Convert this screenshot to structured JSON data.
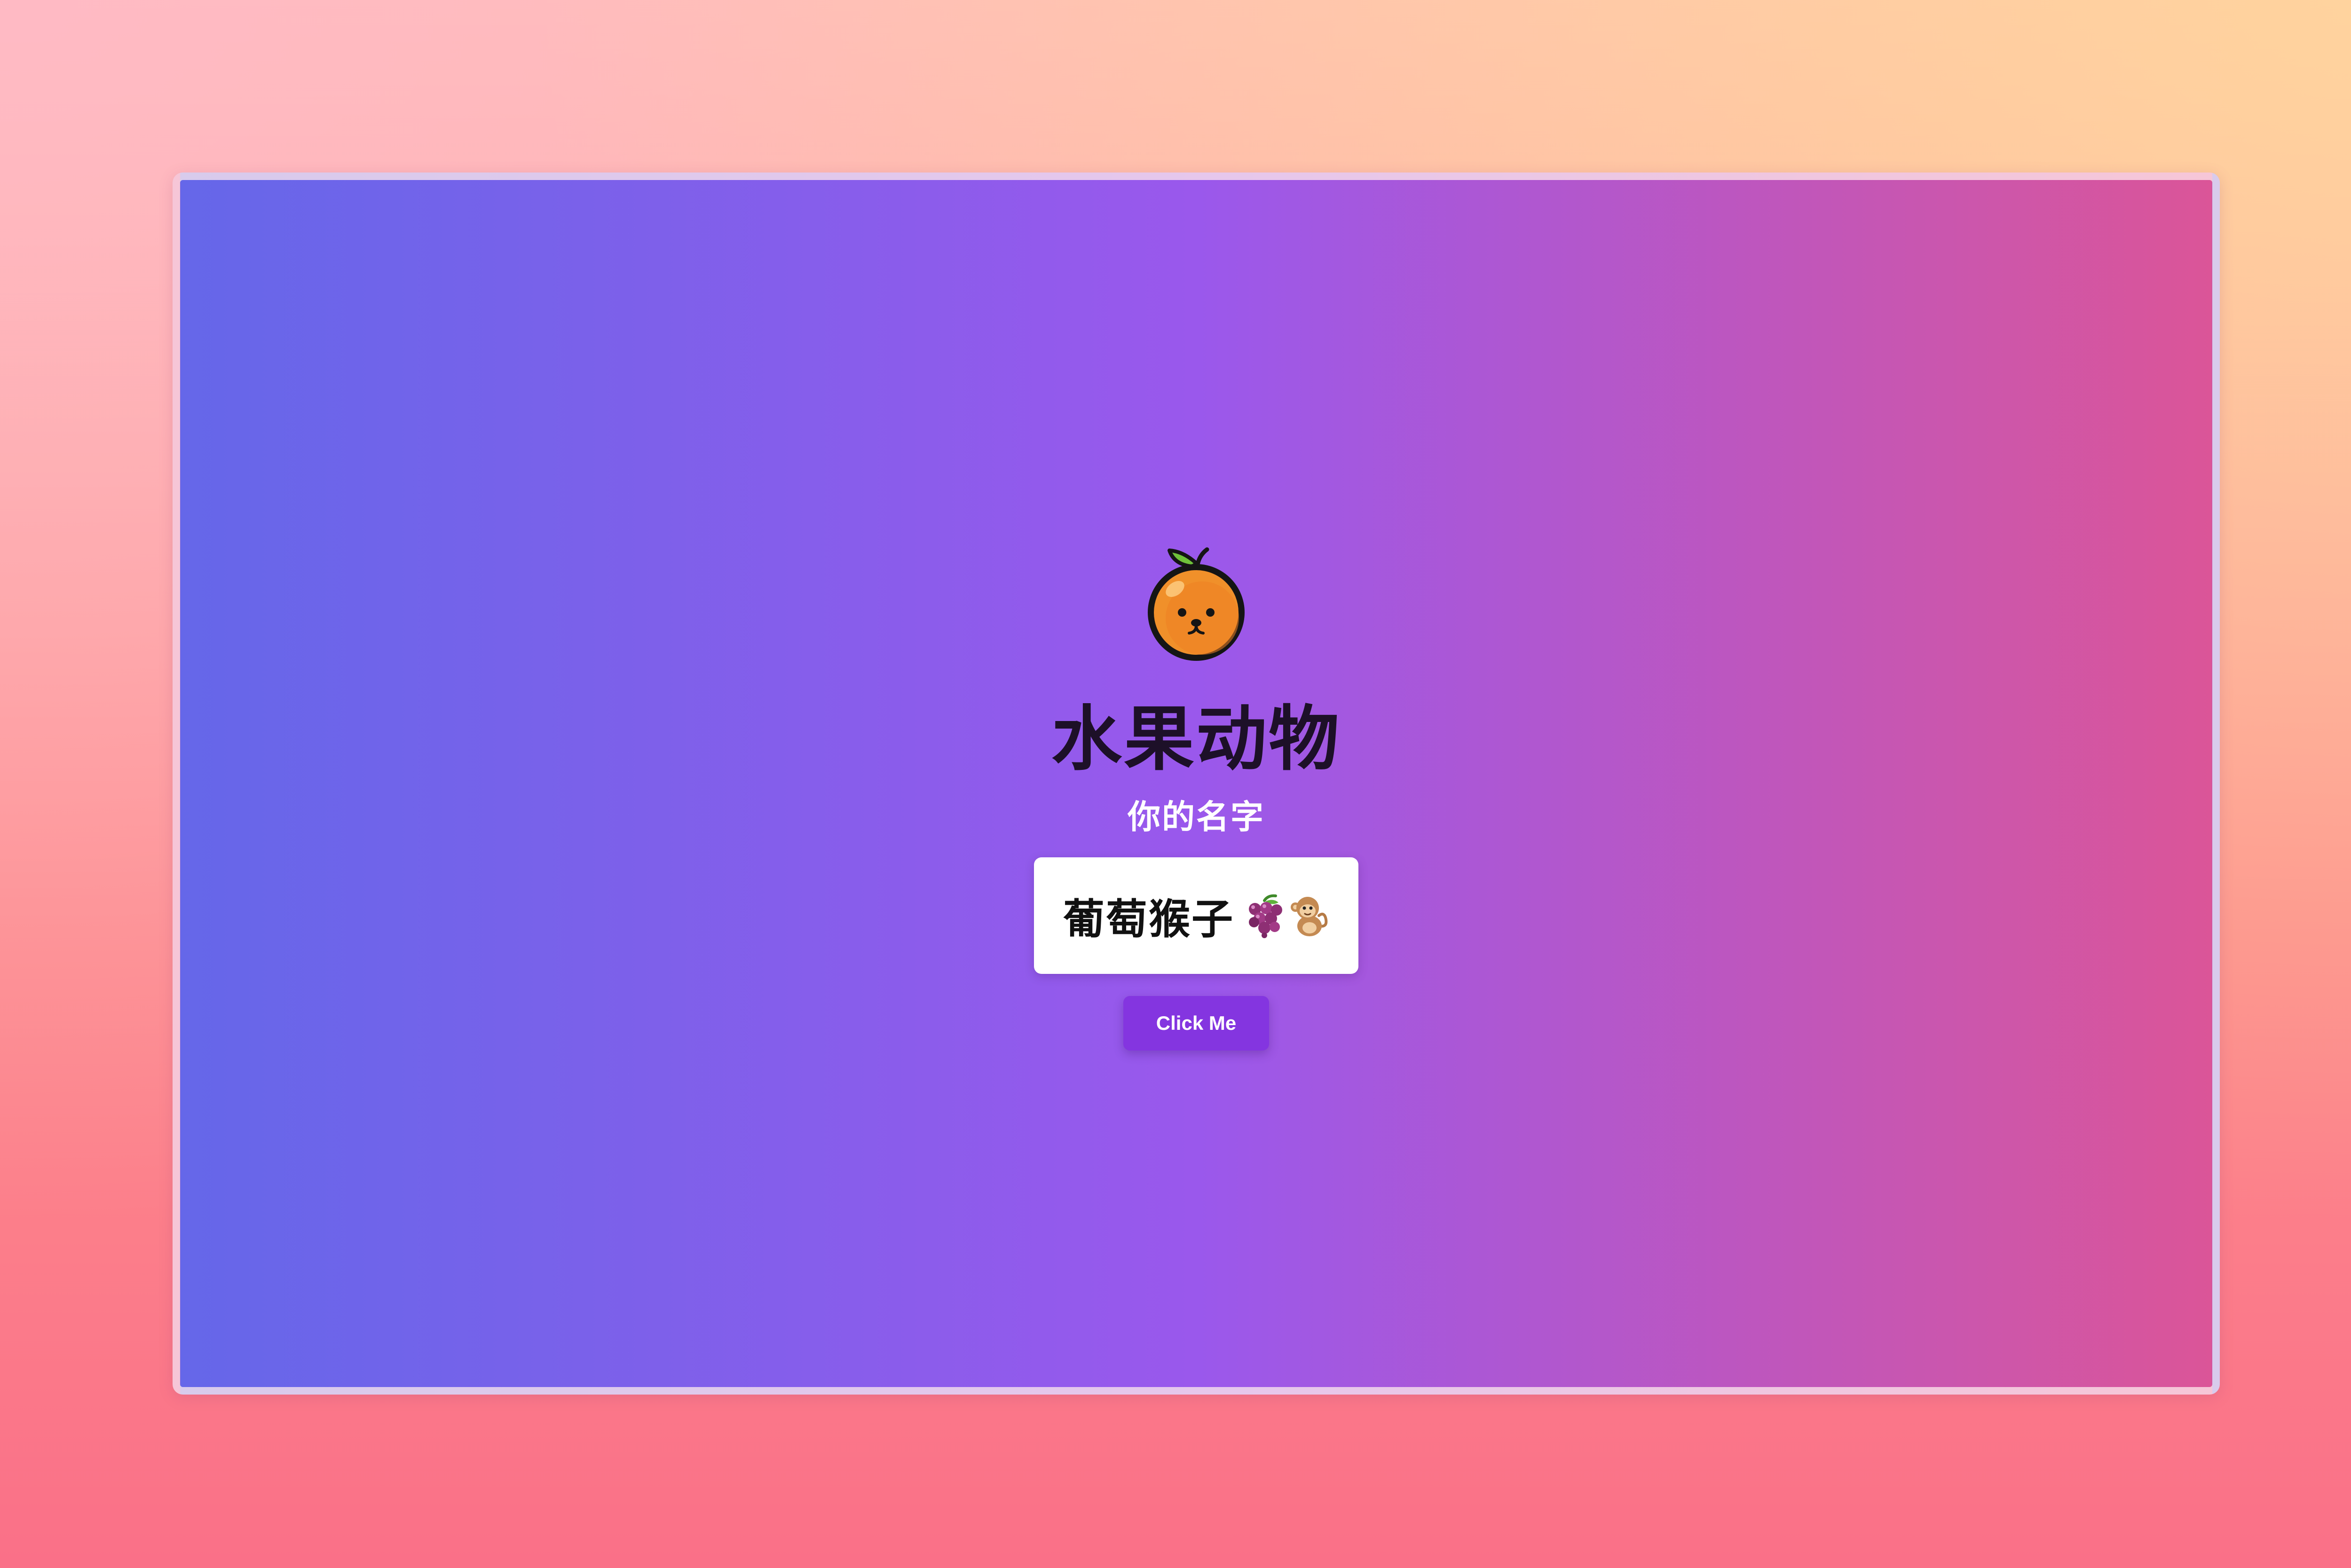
{
  "app": {
    "title": "水果动物",
    "subtitle": "你的名字",
    "logo_icon": "orange-bear-icon"
  },
  "result": {
    "name": "葡萄猴子",
    "emoji_icons": [
      "grapes-icon",
      "monkey-icon"
    ]
  },
  "actions": {
    "click_label": "Click Me"
  },
  "colors": {
    "panel_gradient_start": "#6567e9",
    "panel_gradient_mid": "#9a58ec",
    "panel_gradient_end": "#db5598",
    "button": "#8435e0",
    "title_text": "#1d1028"
  }
}
